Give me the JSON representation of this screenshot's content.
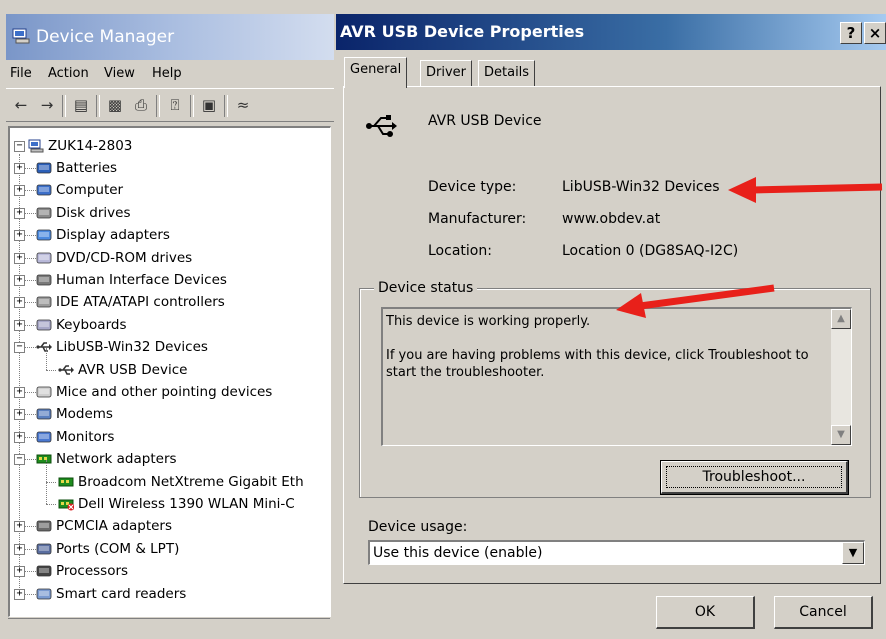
{
  "device_manager": {
    "title": "Device Manager",
    "menu": [
      "File",
      "Action",
      "View",
      "Help"
    ],
    "tree": {
      "root": "ZUK14-2803",
      "items": [
        {
          "label": "Batteries",
          "icon": "battery-icon",
          "expanded": false
        },
        {
          "label": "Computer",
          "icon": "computer-icon",
          "expanded": false
        },
        {
          "label": "Disk drives",
          "icon": "disk-drive-icon",
          "expanded": false
        },
        {
          "label": "Display adapters",
          "icon": "display-adapter-icon",
          "expanded": false
        },
        {
          "label": "DVD/CD-ROM drives",
          "icon": "dvd-drive-icon",
          "expanded": false
        },
        {
          "label": "Human Interface Devices",
          "icon": "hid-icon",
          "expanded": false
        },
        {
          "label": "IDE ATA/ATAPI controllers",
          "icon": "ide-controller-icon",
          "expanded": false
        },
        {
          "label": "Keyboards",
          "icon": "keyboard-icon",
          "expanded": false
        },
        {
          "label": "LibUSB-Win32 Devices",
          "icon": "usb-icon",
          "expanded": true
        },
        {
          "label": "AVR USB Device",
          "icon": "usb-icon",
          "child": true
        },
        {
          "label": "Mice and other pointing devices",
          "icon": "mouse-icon",
          "expanded": false
        },
        {
          "label": "Modems",
          "icon": "modem-icon",
          "expanded": false
        },
        {
          "label": "Monitors",
          "icon": "monitor-icon",
          "expanded": false
        },
        {
          "label": "Network adapters",
          "icon": "network-adapter-icon",
          "expanded": true
        },
        {
          "label": "Broadcom NetXtreme Gigabit Eth",
          "icon": "network-adapter-icon",
          "child": true
        },
        {
          "label": "Dell Wireless 1390 WLAN Mini-C",
          "icon": "network-adapter-disabled-icon",
          "child": true
        },
        {
          "label": "PCMCIA adapters",
          "icon": "pcmcia-icon",
          "expanded": false
        },
        {
          "label": "Ports (COM & LPT)",
          "icon": "port-icon",
          "expanded": false
        },
        {
          "label": "Processors",
          "icon": "processor-icon",
          "expanded": false
        },
        {
          "label": "Smart card readers",
          "icon": "smart-card-icon",
          "expanded": false
        }
      ]
    }
  },
  "dialog": {
    "title": "AVR USB Device Properties",
    "help_button": "?",
    "close_button": "×",
    "tabs": [
      {
        "label": "General",
        "active": true
      },
      {
        "label": "Driver",
        "active": false
      },
      {
        "label": "Details",
        "active": false
      }
    ],
    "device_name": "AVR USB Device",
    "device_type_label": "Device type:",
    "device_type_value": "LibUSB-Win32 Devices",
    "manufacturer_label": "Manufacturer:",
    "manufacturer_value": "www.obdev.at",
    "location_label": "Location:",
    "location_value": "Location 0 (DG8SAQ-I2C)",
    "status_group_label": "Device status",
    "status_line1": "This device is working properly.",
    "status_line2": "If you are having problems with this device, click Troubleshoot to start the troubleshooter.",
    "troubleshoot_button": "Troubleshoot...",
    "usage_label": "Device usage:",
    "usage_value": "Use this device (enable)",
    "ok_button": "OK",
    "cancel_button": "Cancel"
  },
  "annotations": {
    "arrow_color": "#e8201a"
  }
}
